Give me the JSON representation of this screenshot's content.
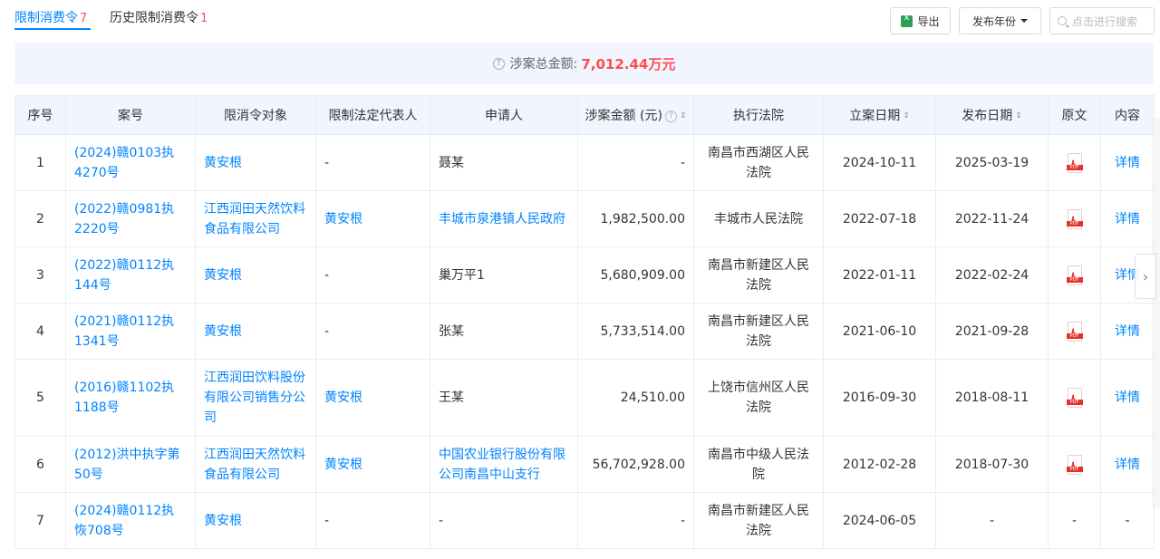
{
  "tabs": [
    {
      "label": "限制消费令",
      "count": "7",
      "active": true
    },
    {
      "label": "历史限制消费令",
      "count": "1",
      "active": false
    }
  ],
  "toolbar": {
    "export_label": "导出",
    "year_label": "发布年份",
    "search_placeholder": "点击进行搜索"
  },
  "summary": {
    "label": "涉案总金额:",
    "amount": "7,012.44万元"
  },
  "table": {
    "headers": [
      "序号",
      "案号",
      "限消令对象",
      "限制法定代表人",
      "申请人",
      "涉案金额 (元)",
      "执行法院",
      "立案日期",
      "发布日期",
      "原文",
      "内容"
    ],
    "rows": [
      {
        "no": "1",
        "case": "(2024)赣0103执4270号",
        "target": "黄安根",
        "legal_rep": "-",
        "applicant": "聂某",
        "applicant_link": false,
        "amount": "-",
        "court": "南昌市西湖区人民法院",
        "filed": "2024-10-11",
        "published": "2025-03-19",
        "has_pdf": true,
        "detail": "详情"
      },
      {
        "no": "2",
        "case": "(2022)赣0981执2220号",
        "target": "江西润田天然饮料食品有限公司",
        "legal_rep": "黄安根",
        "applicant": "丰城市泉港镇人民政府",
        "applicant_link": true,
        "amount": "1,982,500.00",
        "court": "丰城市人民法院",
        "filed": "2022-07-18",
        "published": "2022-11-24",
        "has_pdf": true,
        "detail": "详情"
      },
      {
        "no": "3",
        "case": "(2022)赣0112执144号",
        "target": "黄安根",
        "legal_rep": "-",
        "applicant": "巢万平1",
        "applicant_link": false,
        "amount": "5,680,909.00",
        "court": "南昌市新建区人民法院",
        "filed": "2022-01-11",
        "published": "2022-02-24",
        "has_pdf": true,
        "detail": "详情"
      },
      {
        "no": "4",
        "case": "(2021)赣0112执1341号",
        "target": "黄安根",
        "legal_rep": "-",
        "applicant": "张某",
        "applicant_link": false,
        "amount": "5,733,514.00",
        "court": "南昌市新建区人民法院",
        "filed": "2021-06-10",
        "published": "2021-09-28",
        "has_pdf": true,
        "detail": "详情"
      },
      {
        "no": "5",
        "case": "(2016)赣1102执1188号",
        "target": "江西润田饮料股份有限公司销售分公司",
        "legal_rep": "黄安根",
        "applicant": "王某",
        "applicant_link": false,
        "amount": "24,510.00",
        "court": "上饶市信州区人民法院",
        "filed": "2016-09-30",
        "published": "2018-08-11",
        "has_pdf": true,
        "detail": "详情"
      },
      {
        "no": "6",
        "case": "(2012)洪中执字第50号",
        "target": "江西润田天然饮料食品有限公司",
        "legal_rep": "黄安根",
        "applicant": "中国农业银行股份有限公司南昌中山支行",
        "applicant_link": true,
        "amount": "56,702,928.00",
        "court": "南昌市中级人民法院",
        "filed": "2012-02-28",
        "published": "2018-07-30",
        "has_pdf": true,
        "detail": "详情"
      },
      {
        "no": "7",
        "case": "(2024)赣0112执恢708号",
        "target": "黄安根",
        "legal_rep": "-",
        "applicant": "-",
        "applicant_link": false,
        "amount": "-",
        "court": "南昌市新建区人民法院",
        "filed": "2024-06-05",
        "published": "-",
        "has_pdf": false,
        "pdf_placeholder": "-",
        "detail": "-"
      }
    ]
  },
  "side_arrow": "›",
  "accent_color": "#0084ff",
  "amount_color": "#ff4d4f"
}
